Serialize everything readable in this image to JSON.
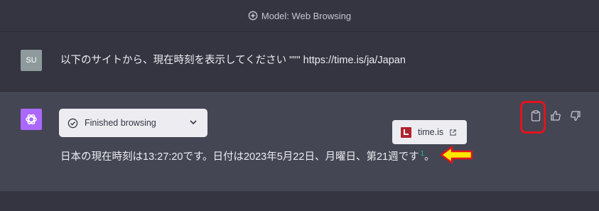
{
  "header": {
    "model_label": "Model: Web Browsing",
    "icon": "model-sparkle-icon"
  },
  "user_message": {
    "avatar_initials": "SU",
    "text": "以下のサイトから、現在時刻を表示してください \"\"\" https://time.is/ja/Japan"
  },
  "assistant_message": {
    "browsing_label": "Finished browsing",
    "answer_text": "日本の現在時刻は13:27:20です。日付は2023年5月22日、月曜日、第21週です",
    "citation_number": "1",
    "answer_end": "。",
    "source_popup": {
      "site_name": "time.is"
    }
  },
  "colors": {
    "background": "#343541",
    "assistant_background": "#444654",
    "gpt_avatar": "#ab68ff",
    "annotation_red": "#e3131c",
    "annotation_arrow": "#ffe800"
  }
}
